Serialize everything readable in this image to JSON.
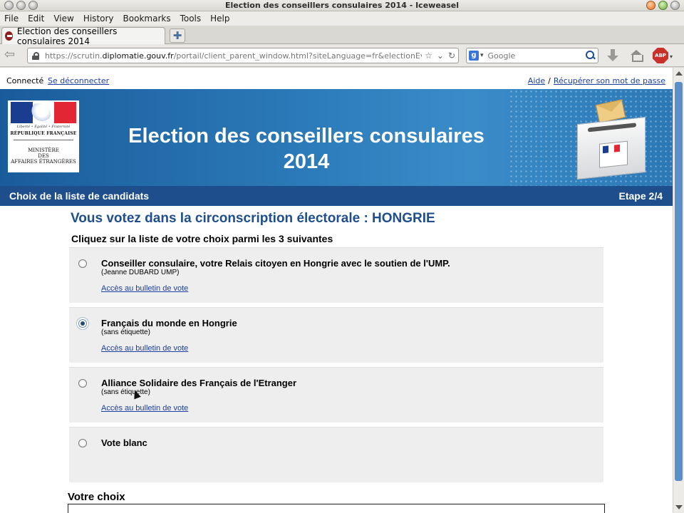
{
  "window": {
    "title": "Election des conseillers consulaires 2014 - Iceweasel"
  },
  "menu": [
    "File",
    "Edit",
    "View",
    "History",
    "Bookmarks",
    "Tools",
    "Help"
  ],
  "tab": {
    "label": "Election des conseillers consulaires 2014",
    "new_tab_glyph": "✚"
  },
  "nav": {
    "back_glyph": "⇦",
    "url_prefix": "https://scrutin.",
    "url_domain": "diplomatie.gouv.fr",
    "url_suffix": "/portail/client_parent_window.html?siteLanguage=fr&electionEventId=fl",
    "url_icons": [
      "☆",
      "⌄",
      "↻"
    ],
    "search_engine_letter": "g",
    "search_caret": "▾",
    "search_placeholder": "Google",
    "abp_label": "ABP",
    "abp_caret": "▾"
  },
  "page": {
    "status": "Connecté",
    "logout": "Se déconnecter",
    "help": "Aide",
    "separator": "/",
    "recover_password": "Récupérer son mot de passe",
    "logo": {
      "motto": "Liberté • Égalité • Fraternité",
      "republique": "RÉPUBLIQUE FRANÇAISE",
      "ministry_line1": "MINISTÈRE",
      "ministry_line2": "DES",
      "ministry_line3": "AFFAIRES ÉTRANGÈRES"
    },
    "banner_title_line1": "Election des conseillers consulaires",
    "banner_title_line2": "2014",
    "step_left": "Choix de la liste de candidats",
    "step_right": "Etape 2/4",
    "circonscription": "Vous votez dans la circonscription électorale : HONGRIE",
    "instruction": "Cliquez sur la liste de votre choix parmi les 3 suivantes",
    "choices": [
      {
        "title": "Conseiller consulaire, votre Relais citoyen en Hongrie avec le soutien de l'UMP.",
        "subtitle": "(Jeanne DUBARD UMP)",
        "link": "Accès au bulletin de vote",
        "selected": false
      },
      {
        "title": "Français du monde en Hongrie",
        "subtitle": "(sans étiquette)",
        "link": "Accès au bulletin de vote",
        "selected": true
      },
      {
        "title": "Alliance Solidaire des Français de l'Etranger",
        "subtitle": "(sans étiquette)",
        "link": "Accès au bulletin de vote",
        "selected": false
      },
      {
        "title": "Vote blanc",
        "subtitle": "",
        "link": "",
        "selected": false
      }
    ],
    "votre_choix": "Votre choix"
  },
  "colors": {
    "banner_blue": "#1f4e8c",
    "link_blue": "#1d3fa0",
    "flag_blue": "#1a3d8f",
    "flag_red": "#e32634"
  }
}
